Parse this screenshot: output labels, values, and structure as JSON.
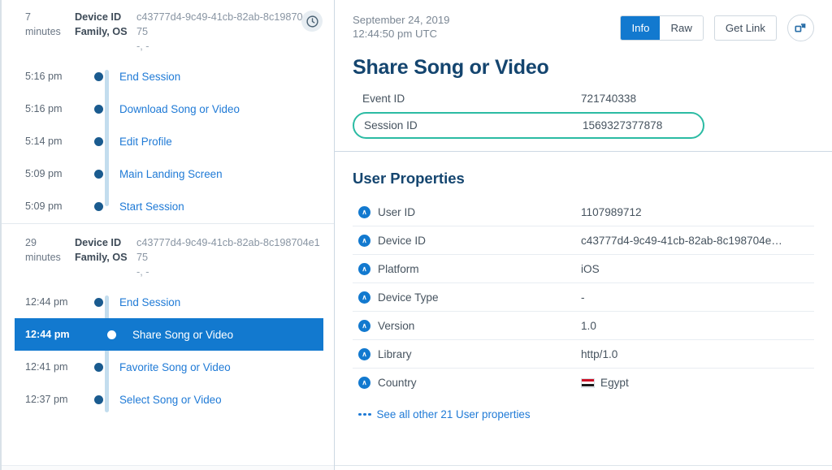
{
  "left_panel": {
    "sessions": [
      {
        "duration_line1": "7",
        "duration_line2": "minutes",
        "meta_key_1": "Device ID",
        "meta_key_2": "Family, OS",
        "meta_val_1": "c43777d4-9c49-41cb-82ab-8c198704e175",
        "meta_val_2": "-, -",
        "has_clock_badge": true,
        "clock_icon": "clock-icon",
        "events": [
          {
            "time": "5:16 pm",
            "name": "End Session",
            "selected": false
          },
          {
            "time": "5:16 pm",
            "name": "Download Song or Video",
            "selected": false
          },
          {
            "time": "5:14 pm",
            "name": "Edit Profile",
            "selected": false
          },
          {
            "time": "5:09 pm",
            "name": "Main Landing Screen",
            "selected": false
          },
          {
            "time": "5:09 pm",
            "name": "Start Session",
            "selected": false
          }
        ]
      },
      {
        "duration_line1": "29",
        "duration_line2": "minutes",
        "meta_key_1": "Device ID",
        "meta_key_2": "Family, OS",
        "meta_val_1": "c43777d4-9c49-41cb-82ab-8c198704e175",
        "meta_val_2": "-, -",
        "has_clock_badge": false,
        "clock_icon": "clock-icon",
        "events": [
          {
            "time": "12:44 pm",
            "name": "End Session",
            "selected": false
          },
          {
            "time": "12:44 pm",
            "name": "Share Song or Video",
            "selected": true
          },
          {
            "time": "12:41 pm",
            "name": "Favorite Song or Video",
            "selected": false
          },
          {
            "time": "12:37 pm",
            "name": "Select Song or Video",
            "selected": false
          }
        ]
      }
    ]
  },
  "detail_panel": {
    "timestamp_date": "September 24, 2019",
    "timestamp_time": "12:44:50 pm UTC",
    "title": "Share Song or Video",
    "actions": {
      "info_label": "Info",
      "raw_label": "Raw",
      "get_link_label": "Get Link",
      "expand_icon": "expand-icon"
    },
    "ids": [
      {
        "label": "Event ID",
        "value": "721740338",
        "highlighted": false
      },
      {
        "label": "Session ID",
        "value": "1569327377878",
        "highlighted": true
      }
    ],
    "user_properties": {
      "heading": "User Properties",
      "rows": [
        {
          "icon": "user-property-icon",
          "label": "User ID",
          "value": "1107989712"
        },
        {
          "icon": "user-property-icon",
          "label": "Device ID",
          "value": "c43777d4-9c49-41cb-82ab-8c198704e…"
        },
        {
          "icon": "user-property-icon",
          "label": "Platform",
          "value": "iOS"
        },
        {
          "icon": "user-property-icon",
          "label": "Device Type",
          "value": "-"
        },
        {
          "icon": "user-property-icon",
          "label": "Version",
          "value": "1.0"
        },
        {
          "icon": "user-property-icon",
          "label": "Library",
          "value": "http/1.0"
        },
        {
          "icon": "user-property-icon",
          "label": "Country",
          "value": "Egypt",
          "flag": "flag-egypt-icon"
        }
      ],
      "see_all_label": "See all other 21 User properties"
    }
  },
  "colors": {
    "accent_blue": "#1279cf",
    "link_blue": "#1f7ad6",
    "navy": "#14456f",
    "timeline_line": "#c3ddee",
    "timeline_dot": "#1a5b8f",
    "highlight_teal": "#2bbba3"
  }
}
